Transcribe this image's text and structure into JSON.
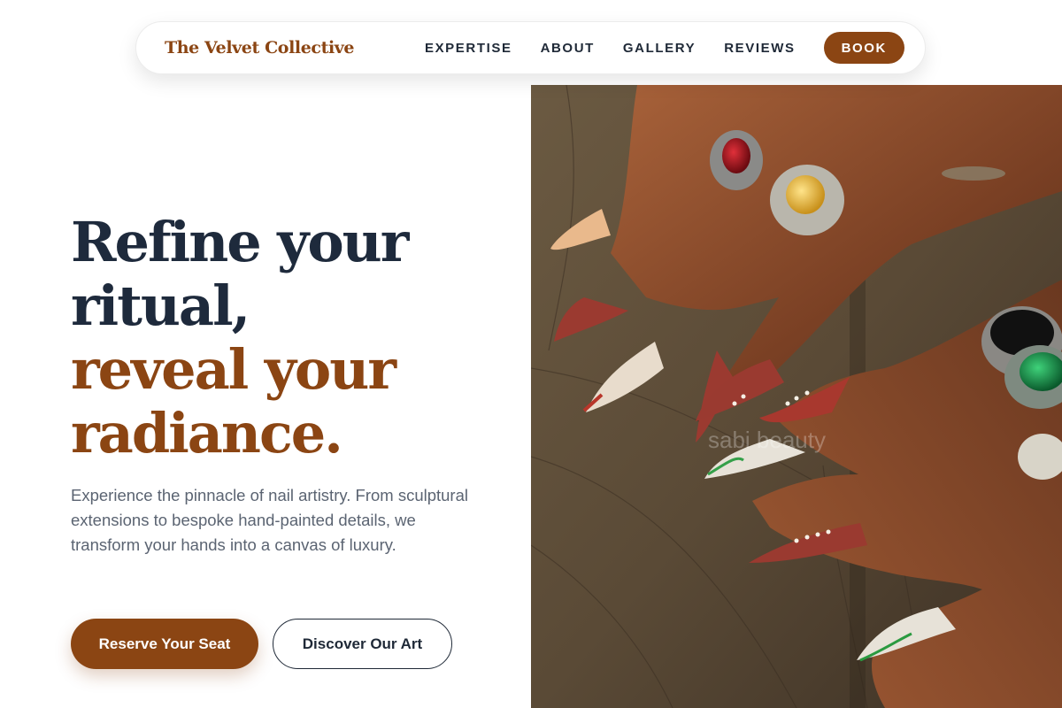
{
  "nav": {
    "brand": "The Velvet Collective",
    "links": [
      "EXPERTISE",
      "ABOUT",
      "GALLERY",
      "REVIEWS"
    ],
    "cta": "BOOK"
  },
  "hero": {
    "title_lines_dark": [
      "Refine your",
      "ritual,"
    ],
    "title_lines_accent": [
      "reveal your",
      "radiance."
    ],
    "description": "Experience the pinnacle of nail artistry. From sculptural extensions to bespoke hand-painted details, we transform your hands into a canvas of luxury.",
    "primary_button": "Reserve Your Seat",
    "secondary_button": "Discover Our Art"
  },
  "image": {
    "alt": "Hands with long decorated nails and ornate rings resting on weathered wood",
    "watermark": "sabi beauty"
  },
  "colors": {
    "brand": "#8b4513",
    "heading": "#1e2a3c",
    "body": "#5b6472"
  }
}
